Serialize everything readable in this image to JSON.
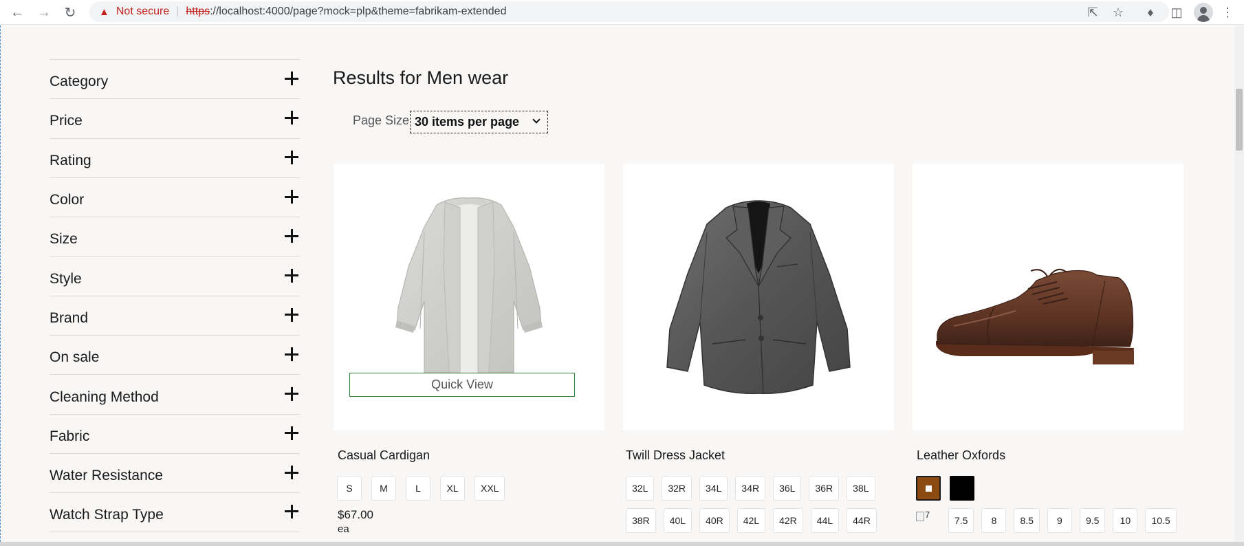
{
  "browser": {
    "security_label": "Not secure",
    "url_protocol": "https",
    "url_rest": "://localhost:4000/page?mock=plp&theme=fabrikam-extended"
  },
  "filters": [
    {
      "label": "Category"
    },
    {
      "label": "Price"
    },
    {
      "label": "Rating"
    },
    {
      "label": "Color"
    },
    {
      "label": "Size"
    },
    {
      "label": "Style"
    },
    {
      "label": "Brand"
    },
    {
      "label": "On sale"
    },
    {
      "label": "Cleaning Method"
    },
    {
      "label": "Fabric"
    },
    {
      "label": "Water Resistance"
    },
    {
      "label": "Watch Strap Type"
    }
  ],
  "results": {
    "title": "Results for Men wear",
    "page_size_label": "Page Size",
    "page_size_value": "30 items per page"
  },
  "products": [
    {
      "name": "Casual Cardigan",
      "quick_view": "Quick View",
      "sizes": [
        "S",
        "M",
        "L",
        "XL",
        "XXL"
      ],
      "price": "$67.00",
      "unit": "ea"
    },
    {
      "name": "Twill Dress Jacket",
      "sizes_row1": [
        "32L",
        "32R",
        "34L",
        "34R",
        "36L",
        "36R",
        "38L"
      ],
      "sizes_row2": [
        "38R",
        "40L",
        "40R",
        "42L",
        "42R",
        "44L",
        "44R"
      ]
    },
    {
      "name": "Leather Oxfords",
      "colors": [
        "#8a4a12",
        "#000000"
      ],
      "broken_image_alt": "7",
      "sizes": [
        "7.5",
        "8",
        "8.5",
        "9",
        "9.5",
        "10",
        "10.5"
      ]
    }
  ]
}
